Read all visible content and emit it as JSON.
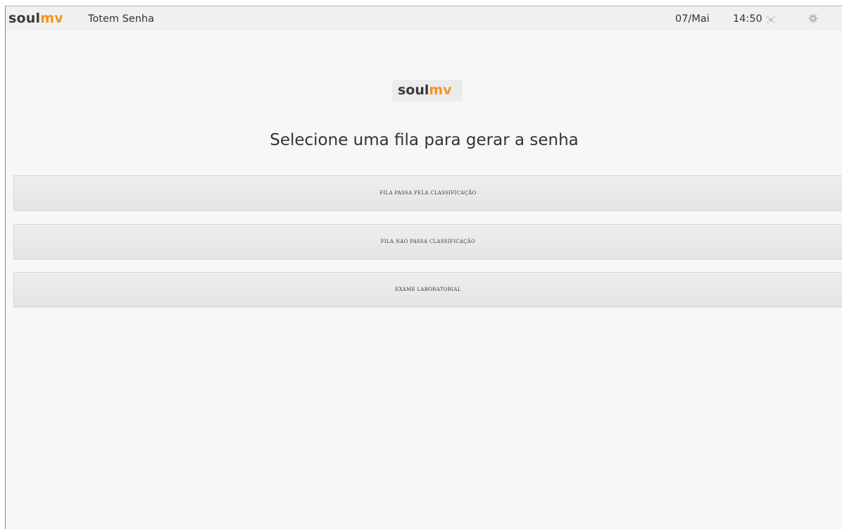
{
  "header": {
    "brand_dark": "soul",
    "brand_orange": "mv",
    "app_title": "Totem Senha",
    "date": "07/Mai",
    "time": "14:50",
    "icons": [
      "fullscreen-icon",
      "gear-icon"
    ]
  },
  "main": {
    "logo_dark": "soul",
    "logo_orange": "mv",
    "headline": "Selecione uma fila para gerar a senha",
    "queues": [
      {
        "label": "FILA PASSA PELA CLASSIFICAÇÃO"
      },
      {
        "label": "FILA NAO PASSA CLASSIFICAÇÃO"
      },
      {
        "label": "EXAME LABORATORIAL"
      }
    ]
  },
  "colors": {
    "brand_orange": "#f7931e",
    "brand_dark": "#3a3a3a",
    "background": "#f7f7f7",
    "button": "#eaeaea"
  }
}
